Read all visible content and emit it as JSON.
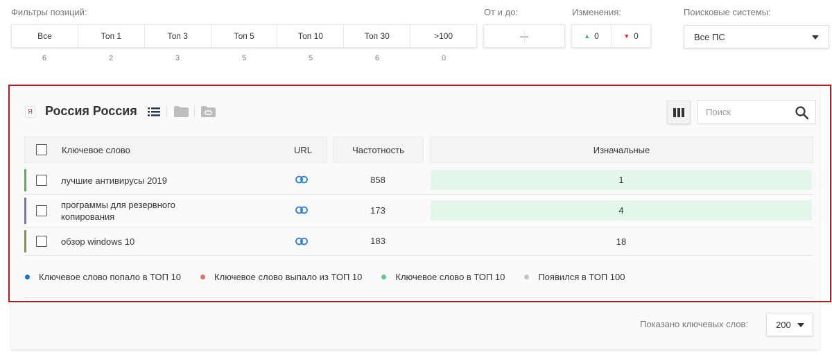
{
  "filters": {
    "positions_label": "Фильтры позиций:",
    "positions": [
      {
        "label": "Все",
        "count": "6"
      },
      {
        "label": "Топ 1",
        "count": "2"
      },
      {
        "label": "Топ 3",
        "count": "3"
      },
      {
        "label": "Топ 5",
        "count": "5"
      },
      {
        "label": "Топ 10",
        "count": "5"
      },
      {
        "label": "Топ 30",
        "count": "6"
      },
      {
        "label": ">100",
        "count": "0"
      }
    ],
    "range_label": "От и до:",
    "range_value": "—",
    "changes_label": "Изменения:",
    "changes_up": "0",
    "changes_down": "0",
    "engines_label": "Поисковые системы:",
    "engines_value": "Все ПС"
  },
  "panel": {
    "engine_icon_text": "Я",
    "title": "Россия Россия",
    "search_placeholder": "Поиск"
  },
  "table": {
    "headers": {
      "keyword": "Ключевое слово",
      "url": "URL",
      "frequency": "Частотность",
      "initial": "Изначальные"
    },
    "rows": [
      {
        "keyword": "лучшие антивирусы 2019",
        "frequency": "858",
        "initial": "1",
        "bar_color": "#4cb84c",
        "highlight": true
      },
      {
        "keyword": "программы для резервного копирования",
        "frequency": "173",
        "initial": "4",
        "bar_color": "#7c6fc4",
        "highlight": true
      },
      {
        "keyword": "обзор windows 10",
        "frequency": "183",
        "initial": "18",
        "bar_color": "#7a9a3c",
        "highlight": false
      }
    ]
  },
  "legend": [
    {
      "label": "Ключевое слово попало в ТОП 10",
      "color": "#1f6fc4"
    },
    {
      "label": "Ключевое слово выпало из ТОП 10",
      "color": "#ec6b6b"
    },
    {
      "label": "Ключевое слово в ТОП 10",
      "color": "#5cc98a"
    },
    {
      "label": "Появился в ТОП 100",
      "color": "#c4c4c4"
    }
  ],
  "footer": {
    "shown_label": "Показано ключевых слов:",
    "page_size": "200"
  }
}
